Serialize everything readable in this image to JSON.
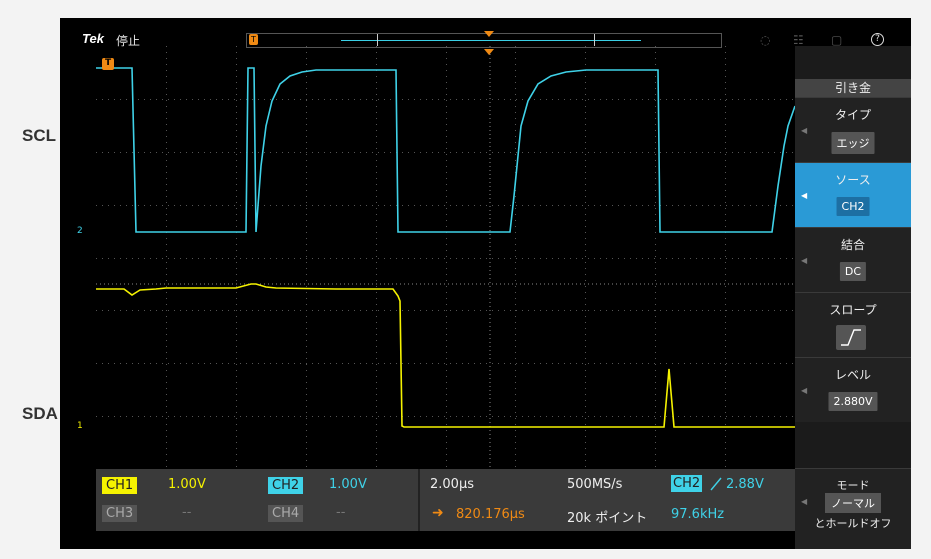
{
  "labels": {
    "scl": "SCL",
    "sda": "SDA"
  },
  "status": {
    "logo": "Tek",
    "run_state": "停止",
    "trigger_marker": "T"
  },
  "markers": {
    "ch2": "2",
    "ch1": "1",
    "trigger": "T"
  },
  "menu": {
    "title": "引き金",
    "items": [
      {
        "label": "タイプ",
        "value": "エッジ",
        "active": false
      },
      {
        "label": "ソース",
        "value": "CH2",
        "active": true
      },
      {
        "label": "結合",
        "value": "DC",
        "active": false
      },
      {
        "label": "スロープ",
        "value": "",
        "active": false
      },
      {
        "label": "レベル",
        "value": "2.880V",
        "active": false
      }
    ],
    "mode": {
      "label": "モード",
      "value": "ノーマル",
      "sub": "とホールドオフ"
    }
  },
  "readout": {
    "ch1": {
      "name": "CH1",
      "scale": "1.00V"
    },
    "ch2": {
      "name": "CH2",
      "scale": "1.00V"
    },
    "ch3": {
      "name": "CH3",
      "scale": "--"
    },
    "ch4": {
      "name": "CH4",
      "scale": "--"
    },
    "timebase": "2.00µs",
    "sample_rate": "500MS/s",
    "trigger_source": "CH2",
    "trigger_level": "2.88V",
    "h_position": "820.176µs",
    "record_length": "20k ポイント",
    "frequency": "97.6kHz"
  },
  "colors": {
    "ch1": "#f5f200",
    "ch2": "#3fd2e8",
    "trigger": "#f08a14",
    "active_menu": "#2a9ad6"
  },
  "icons": [
    "wifi-icon",
    "network-icon",
    "save-icon",
    "help-icon"
  ]
}
